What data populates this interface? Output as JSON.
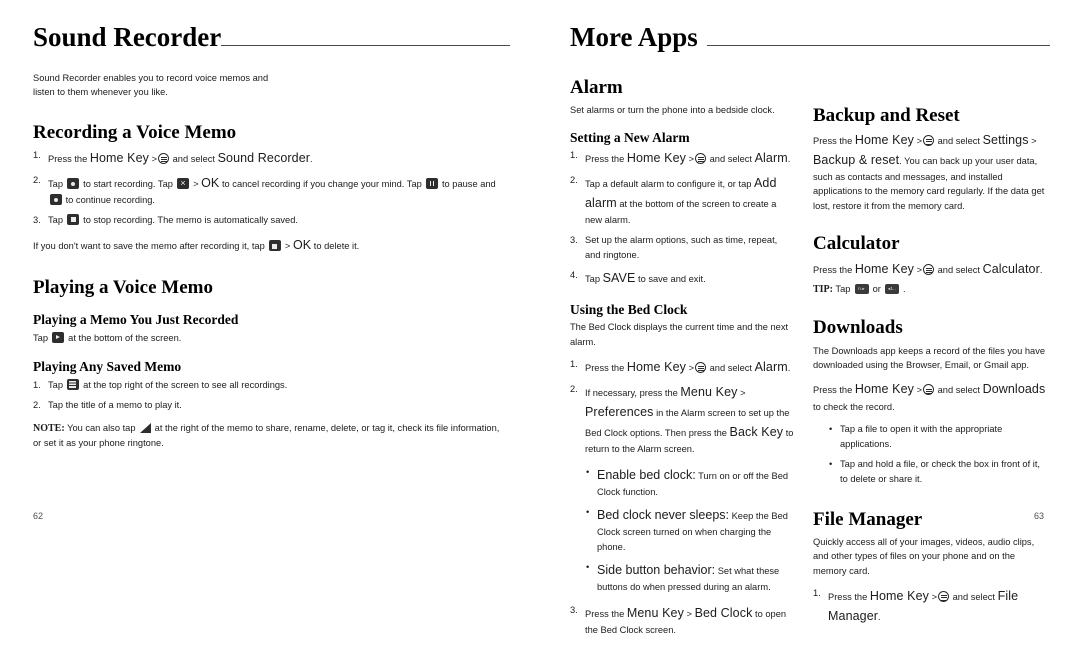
{
  "left_page": {
    "chapter_title": "Sound Recorder",
    "intro": "Sound Recorder enables you to record voice memos and listen to them whenever you like.",
    "sections": [
      {
        "heading": "Recording a Voice Memo",
        "steps": [
          {
            "num": "1.",
            "parts": [
              "Press the ",
              "Home Key",
              " >",
              "home-key-icon",
              " and select ",
              "Sound Recorder",
              "."
            ]
          },
          {
            "num": "2.",
            "parts": [
              "Tap ",
              "record-icon",
              " to start recording. Tap ",
              "cancel-icon",
              " > ",
              "OK",
              " to cancel recording if you change your mind. Tap ",
              "pause-icon",
              " to pause and ",
              "record-icon",
              " to continue recording."
            ]
          },
          {
            "num": "3.",
            "parts": [
              "Tap ",
              "stop-icon",
              " to stop recording. The memo is automatically saved."
            ]
          }
        ],
        "note": "If you don't want to save the memo after recording it, tap [trash] > OK to delete it."
      },
      {
        "heading": "Playing a Voice Memo",
        "sub1_heading": "Playing a Memo You Just Recorded",
        "sub1_text": "Tap [play] at the bottom of the screen.",
        "sub2_heading": "Playing Any Saved Memo",
        "sub2_steps": [
          {
            "num": "1.",
            "text": "Tap [list] at the top right of the screen to see all recordings."
          },
          {
            "num": "2.",
            "text": "Tap the title of a memo to play it."
          }
        ],
        "final_note_label": "NOTE:",
        "final_note": "You can also tap [tri] at the right of the memo to share, rename, delete, or tag it, check its file information, or set it as your phone ringtone."
      }
    ],
    "page_number": "62"
  },
  "right_page": {
    "chapter_title": "More Apps",
    "page_number": "63",
    "col_a": {
      "alarm": {
        "heading": "Alarm",
        "intro": "Set alarms or turn the phone into a bedside clock.",
        "sub_heading": "Setting a New Alarm",
        "steps": [
          {
            "num": "1.",
            "text": "Press the Home Key >[home] and select Alarm."
          },
          {
            "num": "2.",
            "text": "Tap a default alarm to configure it, or tap Add alarm at the bottom of the screen to create a new alarm."
          },
          {
            "num": "3.",
            "text": "Set up the alarm options, such as time, repeat, and ringtone."
          },
          {
            "num": "4.",
            "text": "Tap SAVE to save and exit."
          }
        ]
      },
      "bedclock": {
        "heading": "Using the Bed Clock",
        "intro": "The Bed Clock displays the current time and the next alarm.",
        "steps": [
          {
            "num": "1.",
            "text": "Press the Home Key >[home] and select Alarm."
          },
          {
            "num": "2.",
            "text": "If necessary, press the Menu Key > Preferences in the Alarm screen to set up the Bed Clock options. Then press the Back Key to return to the Alarm screen."
          }
        ],
        "bullets": [
          {
            "term": "Enable bed clock:",
            "desc": " Turn on or off the Bed Clock function."
          },
          {
            "term": "Bed clock never sleeps:",
            "desc": " Keep the Bed Clock screen turned on when charging the phone."
          },
          {
            "term": "Side button behavior:",
            "desc": " Set what these buttons do when pressed during an alarm."
          }
        ],
        "step3": {
          "num": "3.",
          "text": "Press the Menu Key > Bed Clock to open the Bed Clock screen."
        }
      }
    },
    "col_b": {
      "backup": {
        "heading": "Backup and Reset",
        "text": "Press the Home Key >[home] and select Settings > Backup & reset. You can back up your user data, such as contacts and messages, and installed applications to the memory card regularly. If the data get lost, restore it from the memory card."
      },
      "calculator": {
        "heading": "Calculator",
        "text": "Press the Home Key >[home] and select Calculator.",
        "tip_label": "TIP:",
        "tip_text": "Tap [tipA] or [tipB] .",
        "tip_icon_a": "n.▸",
        "tip_icon_b": "◂1.."
      },
      "downloads": {
        "heading": "Downloads",
        "intro": "The Downloads app keeps a record of the files you have downloaded using the Browser, Email, or Gmail app.",
        "text2": "Press the Home Key >[home] and select Downloads to check the record.",
        "bullets": [
          "Tap a file to open it with the appropriate applications.",
          "Tap and hold a file, or check the box in front of it, to delete or share it."
        ]
      },
      "filemanager": {
        "heading": "File Manager",
        "intro": "Quickly access all of your images, videos, audio clips, and other types of files on your phone and on the memory card.",
        "step": {
          "num": "1.",
          "text": "Press the Home Key >[home] and select File Manager."
        }
      }
    }
  },
  "text_fragments": {
    "press_the": "Press the ",
    "home_key": "Home Key",
    "gt": " >",
    "and_select": " and select ",
    "sound_recorder": "Sound Recorder",
    "period": ".",
    "tap": "Tap ",
    "to_start_recording": " to start recording. Tap ",
    "ok_cancel_a": " > ",
    "ok": "OK",
    "ok_cancel_b": " to cancel recording if you change your mind. Tap ",
    "to_pause": " to pause and ",
    "to_continue": " to continue recording.",
    "to_stop": " to stop recording. The memo is automatically saved.",
    "save_note_a": "If you don't want to save the memo after recording it, tap ",
    "save_note_b": " > ",
    "save_note_c": " to delete it.",
    "play_a": "Tap ",
    "play_b": " at the bottom of the screen.",
    "list_a": "Tap ",
    "list_b": " at the top right of the screen to see all recordings.",
    "tap_title": "Tap the title of a memo to play it.",
    "note_a": "You can also tap ",
    "note_b": " at the right of the memo to share, rename, delete, or tag it, check its file information, or set it as your phone ringtone.",
    "alarm_name": "Alarm",
    "alarm_step2_a": "Tap a default alarm to configure it, or tap ",
    "add_alarm": "Add alarm",
    "alarm_step2_b": " at the bottom of the screen to create a new alarm.",
    "alarm_step3": "Set up the alarm options, such as time, repeat, and ringtone.",
    "alarm_step4_a": "Tap ",
    "save_word": "SAVE",
    "alarm_step4_b": " to save and exit.",
    "bed_intro": "The Bed Clock displays the current time and the next alarm.",
    "bed2_a": "If necessary, press the ",
    "menu_key": "Menu Key",
    "gt_space": " > ",
    "preferences": "Preferences",
    "bed2_b": " in the Alarm screen to set up the Bed Clock options. Then press the ",
    "back_key": "Back Key",
    "bed2_c": " to return to the Alarm screen.",
    "bed3_a": "Press the ",
    "bed_clock": "Bed Clock",
    "bed3_b": " to open the Bed Clock screen.",
    "settings": "Settings",
    "backup_reset": "Backup & reset",
    "backup_rest": " You can back up your user data, such as contacts and messages, and installed applications to the memory card regularly. If the data get lost, restore it from the memory card.",
    "calculator_name": "Calculator",
    "downloads_name": "Downloads",
    "downloads_rest": " to check the record.",
    "file_manager_name": "File Manager"
  }
}
